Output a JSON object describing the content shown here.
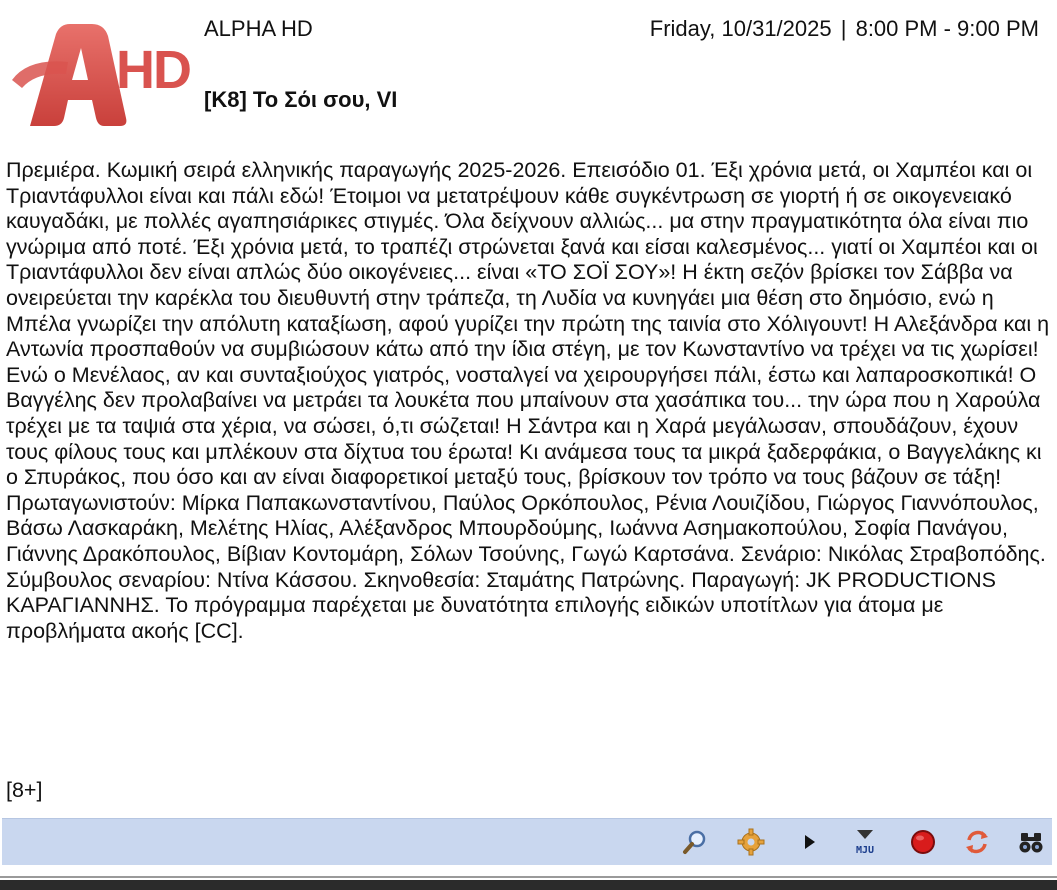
{
  "header": {
    "channel": "ALPHA HD",
    "date": "Friday, 10/31/2025",
    "separator": "|",
    "time": "8:00 PM - 9:00 PM",
    "title": "[K8] Το Σόι σου, VI"
  },
  "logo": {
    "text": "HD",
    "color": "#d9534f"
  },
  "program": {
    "description": "Πρεμιέρα. Κωμική σειρά ελληνικής παραγωγής 2025-2026. Επεισόδιο 01. Έξι χρόνια μετά, οι Χαμπέοι και οι Τριαντάφυλλοι είναι και πάλι εδώ! Έτοιμοι να μετατρέψουν κάθε συγκέντρωση σε γιορτή ή σε οικογενειακό καυγαδάκι, με πολλές αγαπησιάρικες στιγμές. Όλα δείχνουν αλλιώς... μα στην πραγματικότητα όλα είναι πιο γνώριμα από ποτέ. Έξι χρόνια μετά, το τραπέζι στρώνεται ξανά και είσαι καλεσμένος... γιατί οι Χαμπέοι και οι Τριαντάφυλλοι δεν είναι απλώς δύο οικογένειες... είναι «ΤΟ ΣΟΪ ΣΟΥ»! Η έκτη σεζόν βρίσκει τον Σάββα να ονειρεύεται την καρέκλα του διευθυντή στην τράπεζα, τη Λυδία να κυνηγάει μια θέση στο δημόσιο, ενώ η Μπέλα γνωρίζει την απόλυτη καταξίωση, αφού γυρίζει την πρώτη της ταινία στο Χόλιγουντ! Η Αλεξάνδρα και η Αντωνία προσπαθούν να συμβιώσουν κάτω από την ίδια στέγη, με τον Κωνσταντίνο να τρέχει να τις χωρίσει! Ενώ ο Μενέλαος, αν και συνταξιούχος γιατρός, νοσταλγεί να χειρουργήσει πάλι, έστω και λαπαροσκοπικά! Ο Βαγγέλης δεν προλαβαίνει να μετράει τα λουκέτα που μπαίνουν στα χασάπικα του... την ώρα που η Χαρούλα τρέχει με τα ταψιά στα χέρια, να σώσει, ό,τι σώζεται! Η Σάντρα και η Χαρά μεγάλωσαν, σπουδάζουν, έχουν τους φίλους τους και μπλέκουν στα δίχτυα του έρωτα! Κι ανάμεσα τους τα μικρά ξαδερφάκια, ο Βαγγελάκης κι ο Σπυράκος, που όσο και αν είναι διαφορετικοί μεταξύ τους, βρίσκουν τον τρόπο να τους βάζουν σε τάξη! Πρωταγωνιστούν: Μίρκα Παπακωνσταντίνου, Παύλος Ορκόπουλος, Ρένια Λουιζίδου, Γιώργος Γιαννόπουλος, Βάσω Λασκαράκη, Μελέτης Ηλίας, Αλέξανδρος Μπουρδούμης, Ιωάννα Ασημακοπούλου, Σοφία Πανάγου, Γιάννης Δρακόπουλος, Βίβιαν Κοντομάρη, Σόλων Τσούνης, Γωγώ Καρτσάνα. Σενάριο: Νικόλας Στραβοπόδης. Σύμβουλος σεναρίου: Ντίνα Κάσσου. Σκηνοθεσία: Σταμάτης Πατρώνης. Παραγωγή: JK PRODUCTIONS ΚΑΡΑΓΙΑΝΝΗΣ. Το πρόγραμμα παρέχεται με δυνατότητα επιλογής ειδικών υποτίτλων για άτομα με προβλήματα ακοής [CC].",
    "rating": "[8+]"
  },
  "toolbar": {
    "background": "#c9d7ef",
    "icons": [
      "search-icon",
      "settings-gear-icon",
      "play-icon",
      "mju-download-icon",
      "record-icon",
      "refresh-icon",
      "binoculars-icon"
    ],
    "mju_label": "MJU"
  }
}
